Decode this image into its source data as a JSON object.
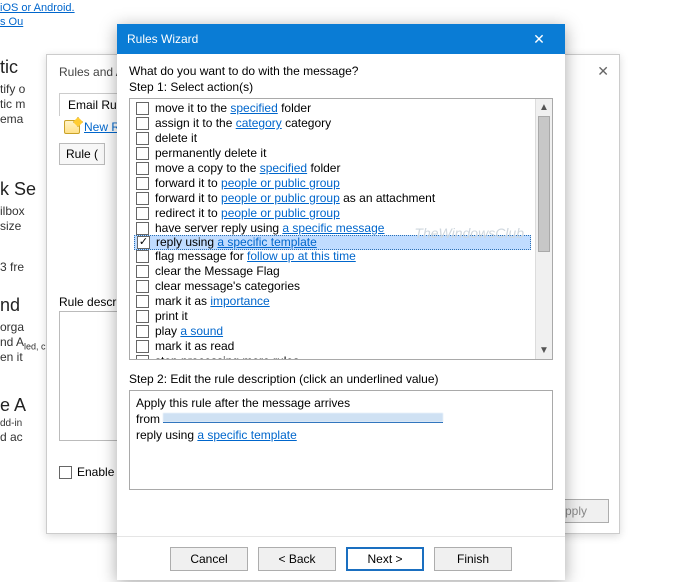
{
  "bg": {
    "toplink": "iOS or Android.",
    "toplink2": "s Ou",
    "frags": {
      "tic_h": "tic",
      "tic_l1": "tify o",
      "tic_l2": "tic m",
      "tic_l3": "ema",
      "se_h": "k Se",
      "se_l1": "ilbox",
      "se_l2": "size",
      "fre": "3 fre",
      "nd_h": "nd",
      "nd_l1": " orga",
      "nd_l2": "nd A",
      "nd_l2b": "led, c",
      "nd_l3": "en it",
      "ea_h": "e A",
      "ea_l1": "dd-in",
      "ea_l2": "d ac"
    }
  },
  "rear": {
    "title": "Rules and A",
    "tab": "Email Rule",
    "new": "New R",
    "listhdr": "Rule (",
    "ruledesc": "Rule descr",
    "enable": "Enable",
    "apply": "Apply"
  },
  "wizard": {
    "title": "Rules Wizard",
    "prompt": "What do you want to do with the message?",
    "step1": "Step 1: Select action(s)",
    "step2": "Step 2: Edit the rule description (click an underlined value)",
    "watermark": "TheWindowsClub",
    "buttons": {
      "cancel": "Cancel",
      "back": "< Back",
      "next": "Next >",
      "finish": "Finish"
    },
    "desc": {
      "line1": "Apply this rule after the message arrives",
      "from": "from ",
      "reply_pre": "reply using ",
      "reply_link": "a specific template"
    }
  },
  "actions": [
    {
      "pre": "move it to the ",
      "link": "specified",
      "post": " folder",
      "checked": false
    },
    {
      "pre": "assign it to the ",
      "link": "category",
      "post": " category",
      "checked": false
    },
    {
      "pre": "delete it",
      "link": "",
      "post": "",
      "checked": false
    },
    {
      "pre": "permanently delete it",
      "link": "",
      "post": "",
      "checked": false
    },
    {
      "pre": "move a copy to the ",
      "link": "specified",
      "post": " folder",
      "checked": false
    },
    {
      "pre": "forward it to ",
      "link": "people or public group",
      "post": "",
      "checked": false
    },
    {
      "pre": "forward it to ",
      "link": "people or public group",
      "post": " as an attachment",
      "checked": false
    },
    {
      "pre": "redirect it to ",
      "link": "people or public group",
      "post": "",
      "checked": false
    },
    {
      "pre": "have server reply using ",
      "link": "a specific message",
      "post": "",
      "checked": false
    },
    {
      "pre": "reply using ",
      "link": "a specific template",
      "post": "",
      "checked": true,
      "selected": true
    },
    {
      "pre": "flag message for ",
      "link": "follow up at this time",
      "post": "",
      "checked": false
    },
    {
      "pre": "clear the Message Flag",
      "link": "",
      "post": "",
      "checked": false
    },
    {
      "pre": "clear message's categories",
      "link": "",
      "post": "",
      "checked": false
    },
    {
      "pre": "mark it as ",
      "link": "importance",
      "post": "",
      "checked": false
    },
    {
      "pre": "print it",
      "link": "",
      "post": "",
      "checked": false
    },
    {
      "pre": "play ",
      "link": "a sound",
      "post": "",
      "checked": false
    },
    {
      "pre": "mark it as read",
      "link": "",
      "post": "",
      "checked": false
    },
    {
      "pre": "stop processing more rules",
      "link": "",
      "post": "",
      "checked": false
    }
  ]
}
